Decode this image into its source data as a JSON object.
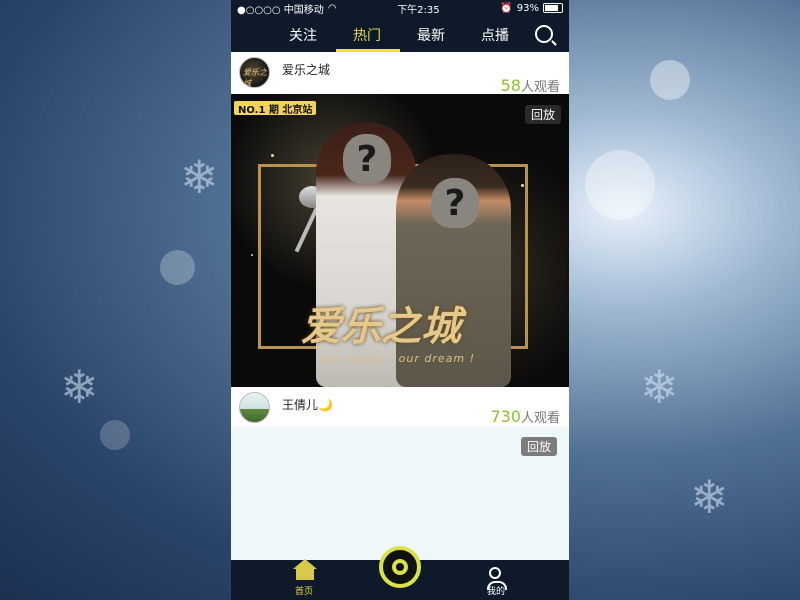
{
  "status_bar": {
    "carrier": "●○○○○ 中国移动",
    "time": "下午2:35",
    "battery": "93%",
    "battery_level": 0.93
  },
  "tabs": [
    {
      "label": "关注"
    },
    {
      "label": "热门",
      "active": true
    },
    {
      "label": "最新"
    },
    {
      "label": "点播"
    }
  ],
  "feed": [
    {
      "name": "爱乐之城",
      "viewer_count": "58",
      "viewer_suffix": "人观看",
      "avatar_text": "爱乐之城",
      "poster": {
        "episode": "NO.1 期  北京站",
        "replay": "回放",
        "title": "爱乐之城",
        "subtitle": "our music ! our dream !"
      }
    },
    {
      "name": "王倩儿🌙",
      "viewer_count": "730",
      "viewer_suffix": "人观看",
      "replay": "回放"
    }
  ],
  "bottom_nav": {
    "home": "首页",
    "mine": "我的"
  },
  "colors": {
    "accent": "#e8d84a",
    "viewer_green": "#8cc12b",
    "nav_bg": "#0e1a2a"
  },
  "icons": {
    "search": "search-icon",
    "home": "home-icon",
    "user": "user-icon",
    "live": "live-record-icon"
  }
}
